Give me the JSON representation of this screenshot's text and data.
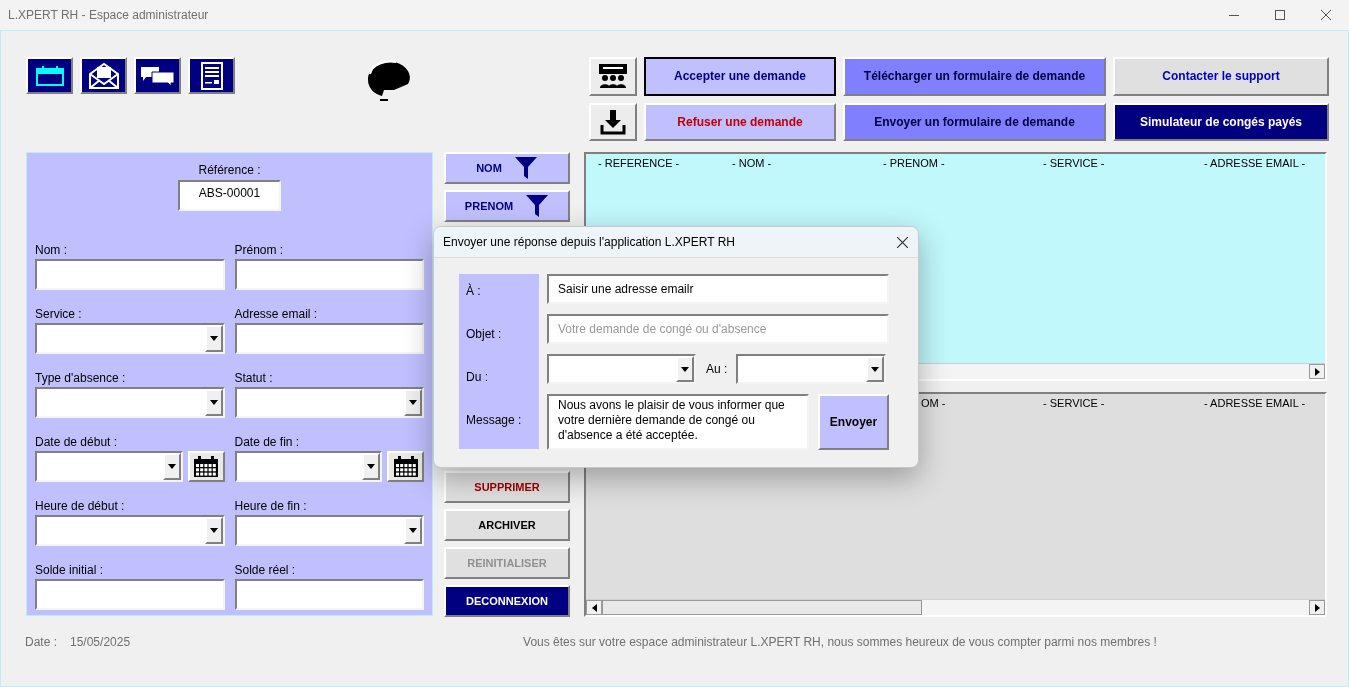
{
  "window": {
    "title": "L.XPERT RH - Espace administrateur"
  },
  "top_buttons": [
    {
      "label": "Accepter une demande",
      "kind": "light",
      "focused": true
    },
    {
      "label": "Télécharger un formulaire de demande",
      "kind": "medium",
      "focused": false
    },
    {
      "label": "Contacter le support",
      "kind": "gray",
      "focused": false
    },
    {
      "label": "Refuser une demande",
      "kind": "danger",
      "focused": false
    },
    {
      "label": "Envoyer un formulaire de demande",
      "kind": "medium",
      "focused": false
    },
    {
      "label": "Simulateur de congés payés",
      "kind": "dark",
      "focused": false
    }
  ],
  "form": {
    "reference": {
      "label": "Référence :",
      "value": "ABS-00001"
    },
    "fields": [
      {
        "label": "Nom :",
        "kind": "text"
      },
      {
        "label": "Prénom :",
        "kind": "text"
      },
      {
        "label": "Service :",
        "kind": "dropdown"
      },
      {
        "label": "Adresse email :",
        "kind": "text"
      },
      {
        "label": "Type d'absence :",
        "kind": "dropdown"
      },
      {
        "label": "Statut :",
        "kind": "dropdown"
      },
      {
        "label": "Date de début :",
        "kind": "date"
      },
      {
        "label": "Date de fin :",
        "kind": "date"
      },
      {
        "label": "Heure de début :",
        "kind": "dropdown"
      },
      {
        "label": "Heure de fin :",
        "kind": "dropdown"
      },
      {
        "label": "Solde initial :",
        "kind": "text"
      },
      {
        "label": "Solde réel :",
        "kind": "text"
      }
    ]
  },
  "side_buttons_top": [
    {
      "label": "NOM",
      "kind": "filter",
      "disabled": false
    },
    {
      "label": "PRENOM",
      "kind": "filter",
      "disabled": false
    }
  ],
  "side_buttons_bottom": [
    {
      "label": "SUPPRIMER",
      "kind": "danger",
      "disabled": false
    },
    {
      "label": "ARCHIVER",
      "kind": "normal",
      "disabled": false
    },
    {
      "label": "REINITIALISER",
      "kind": "normal",
      "disabled": true
    },
    {
      "label": "DECONNEXION",
      "kind": "dark",
      "disabled": false
    }
  ],
  "upper_list": {
    "columns": [
      "- REFERENCE -",
      "- NOM -",
      "- PRENOM -",
      "- SERVICE -",
      "- ADRESSE EMAIL -"
    ]
  },
  "lower_list": {
    "columns": [
      "OM -",
      "- SERVICE -",
      "- ADRESSE EMAIL -"
    ]
  },
  "dialog": {
    "title": "Envoyer une réponse depuis l'application L.XPERT RH",
    "to": {
      "label": "À :",
      "value": "Saisir une adresse emailr"
    },
    "subject": {
      "label": "Objet :",
      "placeholder": "Votre demande de congé ou d'absence"
    },
    "from": {
      "label": "Du :"
    },
    "until": {
      "label": "Au :"
    },
    "message": {
      "label": "Message :",
      "value": "Nous avons le plaisir de vous informer que votre dernière demande de congé ou d'absence a été acceptée."
    },
    "send_button": "Envoyer"
  },
  "footer": {
    "date_label": "Date :",
    "date_value": "15/05/2025",
    "message": "Vous êtes sur votre espace administrateur L.XPERT RH, nous sommes heureux de vous compter parmi nos membres !"
  }
}
